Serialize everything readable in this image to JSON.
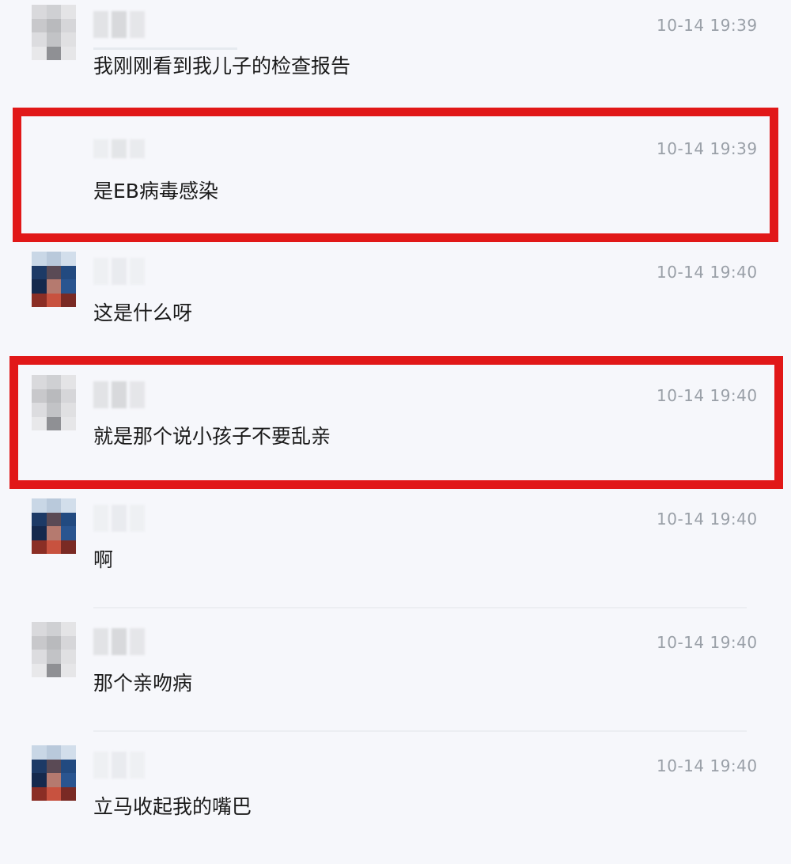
{
  "messages": [
    {
      "text": "我刚刚看到我儿子的检查报告",
      "time": "10-14 19:39"
    },
    {
      "text": "是EB病毒感染",
      "time": "10-14 19:39"
    },
    {
      "text": "这是什么呀",
      "time": "10-14 19:40"
    },
    {
      "text": "就是那个说小孩子不要乱亲",
      "time": "10-14 19:40"
    },
    {
      "text": "啊",
      "time": "10-14 19:40"
    },
    {
      "text": "那个亲吻病",
      "time": "10-14 19:40"
    },
    {
      "text": "立马收起我的嘴巴",
      "time": "10-14 19:40"
    }
  ],
  "colors": {
    "highlight_border": "#e11818",
    "page_background": "#f6f7fb",
    "timestamp": "#9aa0a8"
  }
}
